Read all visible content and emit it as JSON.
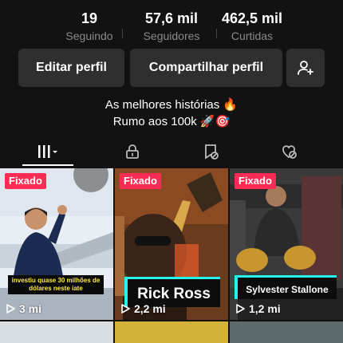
{
  "stats": [
    {
      "value": "19",
      "label": "Seguindo"
    },
    {
      "value": "57,6 mil",
      "label": "Seguidores"
    },
    {
      "value": "462,5 mil",
      "label": "Curtidas"
    }
  ],
  "actions": {
    "edit_profile": "Editar perfil",
    "share_profile": "Compartilhar perfil",
    "add_friend_icon": "person-plus-icon"
  },
  "bio": {
    "line1": "As melhores histórias 🔥",
    "line2": "Rumo aos 100k 🚀🎯"
  },
  "tabs": [
    {
      "icon": "grid-icon",
      "active": true
    },
    {
      "icon": "lock-icon",
      "active": false
    },
    {
      "icon": "favorites-hidden-icon",
      "active": false
    },
    {
      "icon": "liked-hidden-icon",
      "active": false
    }
  ],
  "videos": [
    {
      "pinned_label": "Fixado",
      "caption": "investiu quase 30 milhões de dólares neste iate",
      "views": "3 mi"
    },
    {
      "pinned_label": "Fixado",
      "caption": "Rick Ross",
      "views": "2,2 mi"
    },
    {
      "pinned_label": "Fixado",
      "caption": "Sylvester Stallone",
      "views": "1,2 mi"
    }
  ],
  "colors": {
    "background": "#121212",
    "button": "#2f2f2f",
    "pinned_badge": "#fe2c55",
    "caption_border": "#25f4ee"
  }
}
